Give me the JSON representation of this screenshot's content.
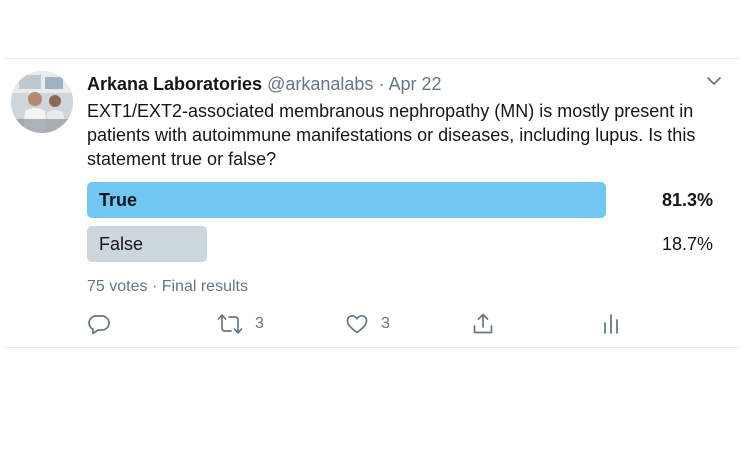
{
  "tweet": {
    "author_name": "Arkana Laboratories",
    "handle": "@arkanalabs",
    "separator": "·",
    "date": "Apr 22",
    "text": "EXT1/EXT2-associated membranous nephropathy (MN) is mostly present in patients with autoimmune manifestations or diseases, including lupus. Is this statement true or false?"
  },
  "poll": {
    "options": [
      {
        "label": "True",
        "percent_text": "81.3%",
        "percent": 81.3,
        "color": "#71c7f1",
        "winner": true
      },
      {
        "label": "False",
        "percent_text": "18.7%",
        "percent": 18.7,
        "color": "#ccd6dd",
        "winner": false
      }
    ],
    "votes_text": "75 votes",
    "separator": "·",
    "status_text": "Final results"
  },
  "actions": {
    "reply_icon": "reply-icon",
    "retweet_icon": "retweet-icon",
    "retweet_count": "3",
    "like_icon": "heart-icon",
    "like_count": "3",
    "share_icon": "share-icon",
    "analytics_icon": "analytics-icon",
    "icon_color": "#657786"
  },
  "colors": {
    "text": "#14171a",
    "secondary": "#657786",
    "divider": "#e6ecf0"
  }
}
